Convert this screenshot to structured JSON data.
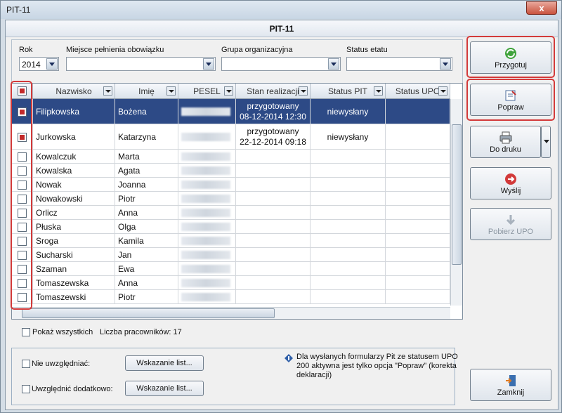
{
  "window": {
    "title": "PIT-11",
    "close_label": "x"
  },
  "header": {
    "title": "PIT-11"
  },
  "filters": {
    "rok": {
      "label": "Rok",
      "value": "2014"
    },
    "miejsce": {
      "label": "Miejsce pełnienia obowiązku",
      "value": ""
    },
    "grupa": {
      "label": "Grupa organizacyjna",
      "value": ""
    },
    "status_etatu": {
      "label": "Status etatu",
      "value": ""
    }
  },
  "grid": {
    "columns": [
      "Nazwisko",
      "Imię",
      "PESEL",
      "Stan realizacji",
      "Status PIT",
      "Status UPO"
    ],
    "rows": [
      {
        "checked": true,
        "nazwisko": "Filipkowska",
        "imie": "Bożena",
        "stan1": "przygotowany",
        "stan2": "08-12-2014 12:30",
        "status_pit": "niewysłany",
        "selected": true
      },
      {
        "checked": true,
        "nazwisko": "Jurkowska",
        "imie": "Katarzyna",
        "stan1": "przygotowany",
        "stan2": "22-12-2014 09:18",
        "status_pit": "niewysłany"
      },
      {
        "checked": false,
        "nazwisko": "Kowalczuk",
        "imie": "Marta"
      },
      {
        "checked": false,
        "nazwisko": "Kowalska",
        "imie": "Agata"
      },
      {
        "checked": false,
        "nazwisko": "Nowak",
        "imie": "Joanna"
      },
      {
        "checked": false,
        "nazwisko": "Nowakowski",
        "imie": "Piotr"
      },
      {
        "checked": false,
        "nazwisko": "Orlicz",
        "imie": "Anna"
      },
      {
        "checked": false,
        "nazwisko": "Płuska",
        "imie": "Olga"
      },
      {
        "checked": false,
        "nazwisko": "Sroga",
        "imie": "Kamila"
      },
      {
        "checked": false,
        "nazwisko": "Sucharski",
        "imie": "Jan"
      },
      {
        "checked": false,
        "nazwisko": "Szaman",
        "imie": "Ewa"
      },
      {
        "checked": false,
        "nazwisko": "Tomaszewska",
        "imie": "Anna"
      },
      {
        "checked": false,
        "nazwisko": "Tomaszewski",
        "imie": "Piotr"
      }
    ]
  },
  "buttons": {
    "przygotuj": "Przygotuj",
    "popraw": "Popraw",
    "do_druku": "Do druku",
    "wyslij": "Wyślij",
    "pobierz_upo": "Pobierz UPO",
    "zamknij": "Zamknij"
  },
  "below_grid": {
    "pokaz_wszystkich": "Pokaż wszystkich",
    "liczba_label": "Liczba pracowników: 17"
  },
  "bottom": {
    "nie_uwzgledniac": "Nie uwzględniać:",
    "uwzglednic_dodatkowo": "Uwzględnić dodatkowo:",
    "wskazanie_btn": "Wskazanie list...",
    "info_text": "Dla wysłanych formularzy Pit ze statusem UPO 200 aktywna jest tylko opcja \"Popraw\" (korekta deklaracji)"
  }
}
